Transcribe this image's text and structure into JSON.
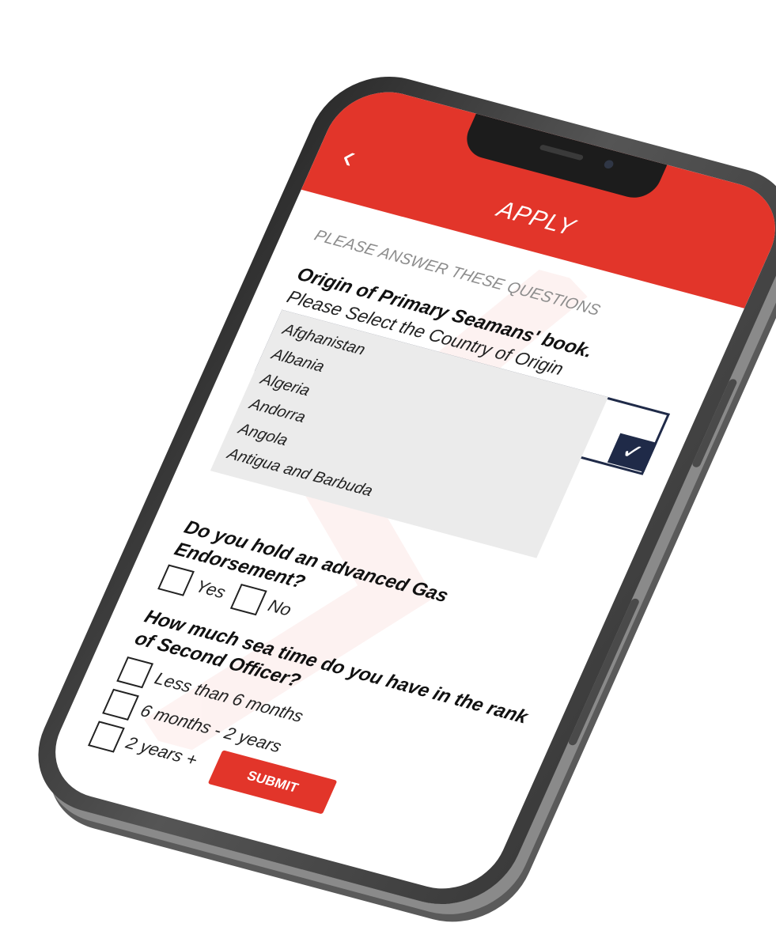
{
  "header": {
    "title": "APPLY",
    "back_glyph": "‹",
    "color": "#e2352a"
  },
  "intro": "PLEASE ANSWER THESE QUESTIONS",
  "q1": {
    "title": "Origin of Primary Seamans' book.",
    "subtitle": "Please Select the Country of Origin",
    "dropdown_icon": "chevron-down-icon",
    "options": [
      "Afghanistan",
      "Albania",
      "Algeria",
      "Andorra",
      "Angola",
      "Antigua and Barbuda"
    ]
  },
  "q2": {
    "title": "Do you hold an advanced Gas Endorsement?",
    "yes_label": "Yes",
    "no_label": "No"
  },
  "q3": {
    "title": "How much sea time do you have in the rank of Second Officer?",
    "options": [
      "Less than 6 months",
      "6 months - 2 years",
      "2 years +"
    ]
  },
  "submit_label": "SUBMIT",
  "colors": {
    "accent": "#e2352a",
    "navy": "#1f2a48",
    "dropdown_bg": "#ebebeb"
  }
}
